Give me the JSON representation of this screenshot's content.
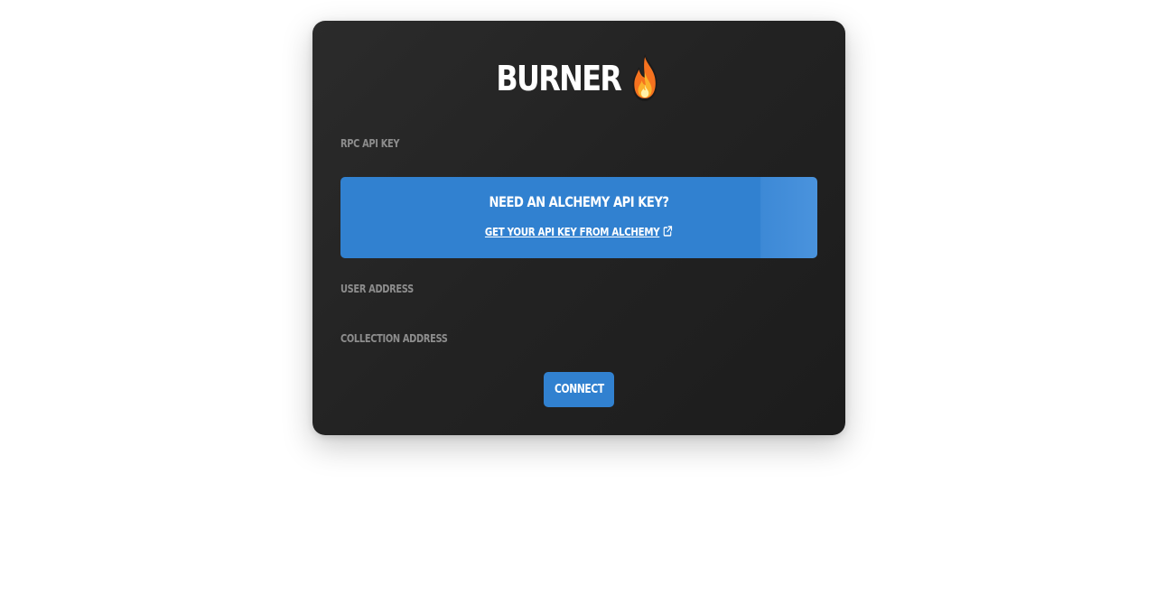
{
  "app": {
    "title": "BURNER",
    "title_icon": "fire-emoji"
  },
  "form": {
    "rpc_label": "RPC API KEY",
    "user_address_label": "USER ADDRESS",
    "collection_address_label": "COLLECTION ADDRESS"
  },
  "alchemy_notice": {
    "heading": "NEED AN ALCHEMY API KEY?",
    "link_text": "GET YOUR API KEY FROM ALCHEMY",
    "link_icon": "external-link-icon"
  },
  "actions": {
    "connect_label": "CONNECT"
  },
  "colors": {
    "accent": "#3181d0",
    "card_bg": "#232323",
    "label": "#8d8d8d"
  }
}
